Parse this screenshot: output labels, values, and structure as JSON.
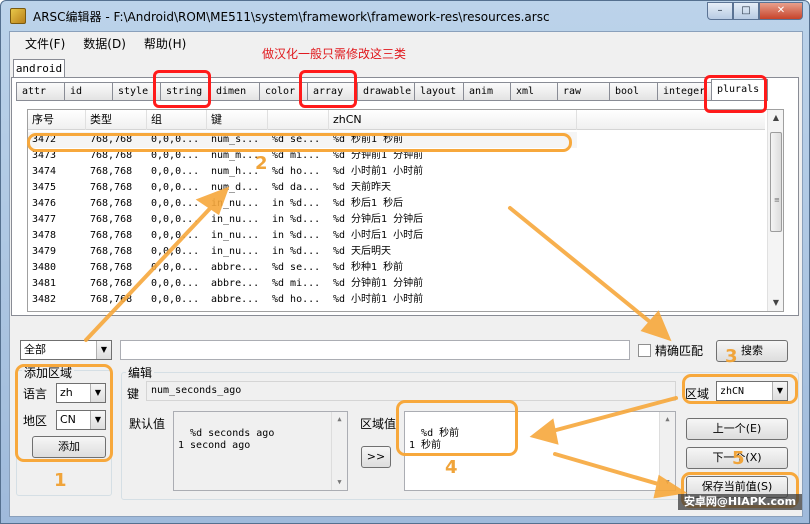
{
  "window": {
    "title": "ARSC编辑器 - F:\\Android\\ROM\\ME511\\system\\framework\\framework-res\\resources.arsc",
    "controls": [
      "–",
      "□",
      "✕"
    ]
  },
  "menu": [
    {
      "label": "文件(F)"
    },
    {
      "label": "数据(D)"
    },
    {
      "label": "帮助(H)"
    }
  ],
  "outer_tab": "android",
  "tabs": [
    "attr",
    "id",
    "style",
    "string",
    "dimen",
    "color",
    "array",
    "drawable",
    "layout",
    "anim",
    "xml",
    "raw",
    "bool",
    "integer",
    "plurals"
  ],
  "active_tab": "plurals",
  "table": {
    "columns": [
      "序号",
      "类型",
      "组",
      "键",
      "",
      "zhCN"
    ],
    "rows": [
      [
        "3472",
        "768,768",
        "0,0,0...",
        "num_s...",
        "%d se...",
        "%d 秒前1 秒前"
      ],
      [
        "3473",
        "768,768",
        "0,0,0...",
        "num_m...",
        "%d mi...",
        "%d 分钟前1 分钟前"
      ],
      [
        "3474",
        "768,768",
        "0,0,0...",
        "num_h...",
        "%d ho...",
        "%d 小时前1 小时前"
      ],
      [
        "3475",
        "768,768",
        "0,0,0...",
        "num_d...",
        "%d da...",
        "%d 天前昨天"
      ],
      [
        "3476",
        "768,768",
        "0,0,0...",
        "in_nu...",
        "in %d...",
        "%d 秒后1 秒后"
      ],
      [
        "3477",
        "768,768",
        "0,0,0...",
        "in_nu...",
        "in %d...",
        "%d 分钟后1 分钟后"
      ],
      [
        "3478",
        "768,768",
        "0,0,0...",
        "in_nu...",
        "in %d...",
        "%d 小时后1 小时后"
      ],
      [
        "3479",
        "768,768",
        "0,0,0...",
        "in_nu...",
        "in %d...",
        "%d 天后明天"
      ],
      [
        "3480",
        "768,768",
        "0,0,0...",
        "abbre...",
        "%d se...",
        "%d 秒种1 秒前"
      ],
      [
        "3481",
        "768,768",
        "0,0,0...",
        "abbre...",
        "%d mi...",
        "%d 分钟前1 分钟前"
      ],
      [
        "3482",
        "768,768",
        "0,0,0...",
        "abbre...",
        "%d ho...",
        "%d 小时前1 小时前"
      ]
    ]
  },
  "filter": {
    "scope_select": "全部",
    "search_value": "",
    "exact_match_label": "精确匹配",
    "search_button": "搜索"
  },
  "add_region": {
    "title": "添加区域",
    "language_label": "语言",
    "language_value": "zh",
    "region_label": "地区",
    "region_value": "CN",
    "add_button": "添加"
  },
  "edit": {
    "title": "编辑",
    "key_label": "键",
    "key_value": "num_seconds_ago",
    "region_label": "区域",
    "region_value": "zhCN",
    "default_label": "默认值",
    "default_value": "%d seconds ago\n1 second ago",
    "region_value_label": "区域值",
    "region_text": "%d 秒前\n1 秒前",
    "copy_button": ">>",
    "prev_button": "上一个(E)",
    "next_button": "下一个(X)",
    "save_button": "保存当前值(S)"
  },
  "annotations": {
    "note": "做汉化一般只需修改这三类",
    "num1": "1",
    "num2": "2",
    "num3": "3",
    "num4": "4",
    "num5": "5"
  },
  "watermark": "安卓网@HIAPK.com",
  "colors": {
    "annotation_red": "#ff1a1a",
    "annotation_orange": "#f7a83c",
    "title_bar": "#bcd3ea"
  }
}
